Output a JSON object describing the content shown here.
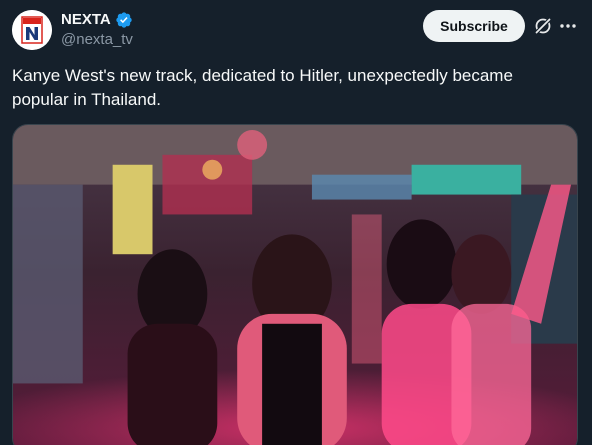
{
  "author": {
    "display_name": "NEXTA",
    "handle": "@nexta_tv",
    "avatar_icon": "nexta-logo-icon",
    "verified_icon": "verified-badge-icon"
  },
  "actions": {
    "subscribe_label": "Subscribe",
    "grok_icon": "grok-icon",
    "more_icon": "more-horizontal-icon"
  },
  "post": {
    "text": "Kanye West's new track, dedicated to Hitler, unexpectedly became popular in Thailand."
  },
  "media": {
    "type": "video-still",
    "description_icon": "video-frame"
  },
  "colors": {
    "background": "#15202b",
    "text_primary": "#f7f9f9",
    "text_secondary": "#8b98a5",
    "verified": "#1d9bf0",
    "subscribe_bg": "#eff3f4",
    "brand_red": "#d9251d"
  }
}
